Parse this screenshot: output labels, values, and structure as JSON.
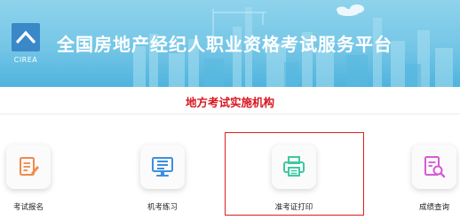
{
  "header": {
    "logo_text": "CIREA",
    "title": "全国房地产经纪人职业资格考试服务平台"
  },
  "section": {
    "title": "地方考试实施机构"
  },
  "services": [
    {
      "label": "考试报名",
      "icon": "form-edit-icon",
      "color": "#f08a4b"
    },
    {
      "label": "机考练习",
      "icon": "computer-icon",
      "color": "#3d8fe0"
    },
    {
      "label": "准考证打印",
      "icon": "printer-icon",
      "color": "#3dc9a0"
    },
    {
      "label": "成绩查询",
      "icon": "search-document-icon",
      "color": "#d65ad6"
    }
  ],
  "colors": {
    "banner": "#74c6e6",
    "accent_red": "#d9161f"
  }
}
